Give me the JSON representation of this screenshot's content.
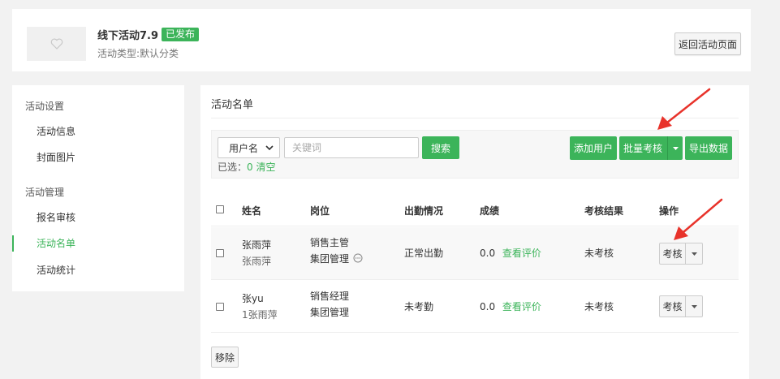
{
  "activity": {
    "title": "线下活动7.9",
    "status_badge": "已发布",
    "subtitle": "活动类型:默认分类",
    "back_button": "返回活动页面"
  },
  "sidebar": {
    "sections": [
      {
        "label": "活动设置",
        "items": [
          {
            "label": "活动信息"
          },
          {
            "label": "封面图片"
          }
        ]
      },
      {
        "label": "活动管理",
        "items": [
          {
            "label": "报名审核"
          },
          {
            "label": "活动名单",
            "active": true
          },
          {
            "label": "活动统计"
          }
        ]
      }
    ]
  },
  "main": {
    "title": "活动名单",
    "filter": {
      "select_value": "用户名",
      "keyword_placeholder": "关键词",
      "search_label": "搜索",
      "selected_prefix": "已选：",
      "selected_count": "0",
      "clear_label": "清空"
    },
    "actions": {
      "add_user": "添加用户",
      "batch_assess": "批量考核",
      "export": "导出数据"
    },
    "table": {
      "headers": {
        "name": "姓名",
        "position": "岗位",
        "attendance": "出勤情况",
        "score": "成绩",
        "result": "考核结果",
        "operation": "操作"
      },
      "rows": [
        {
          "name": "张雨萍",
          "name_sub": "张雨萍",
          "position": "销售主管",
          "position_sub": "集团管理",
          "has_more_icon": true,
          "attendance": "正常出勤",
          "score": "0.0",
          "score_link": "查看评价",
          "result": "未考核",
          "op_label": "考核"
        },
        {
          "name": "张yu",
          "name_sub": "1张雨萍",
          "position": "销售经理",
          "position_sub": "集团管理",
          "has_more_icon": false,
          "attendance": "未考勤",
          "score": "0.0",
          "score_link": "查看评价",
          "result": "未考核",
          "op_label": "考核"
        }
      ]
    },
    "remove_label": "移除"
  },
  "colors": {
    "accent": "#3cb45a",
    "annotation_arrow": "#e8332b"
  },
  "icons": {
    "cover": "heart-icon",
    "select_caret": "chevron-down-icon",
    "split_caret": "caret-down-icon",
    "more": "ellipsis-circle-icon"
  }
}
